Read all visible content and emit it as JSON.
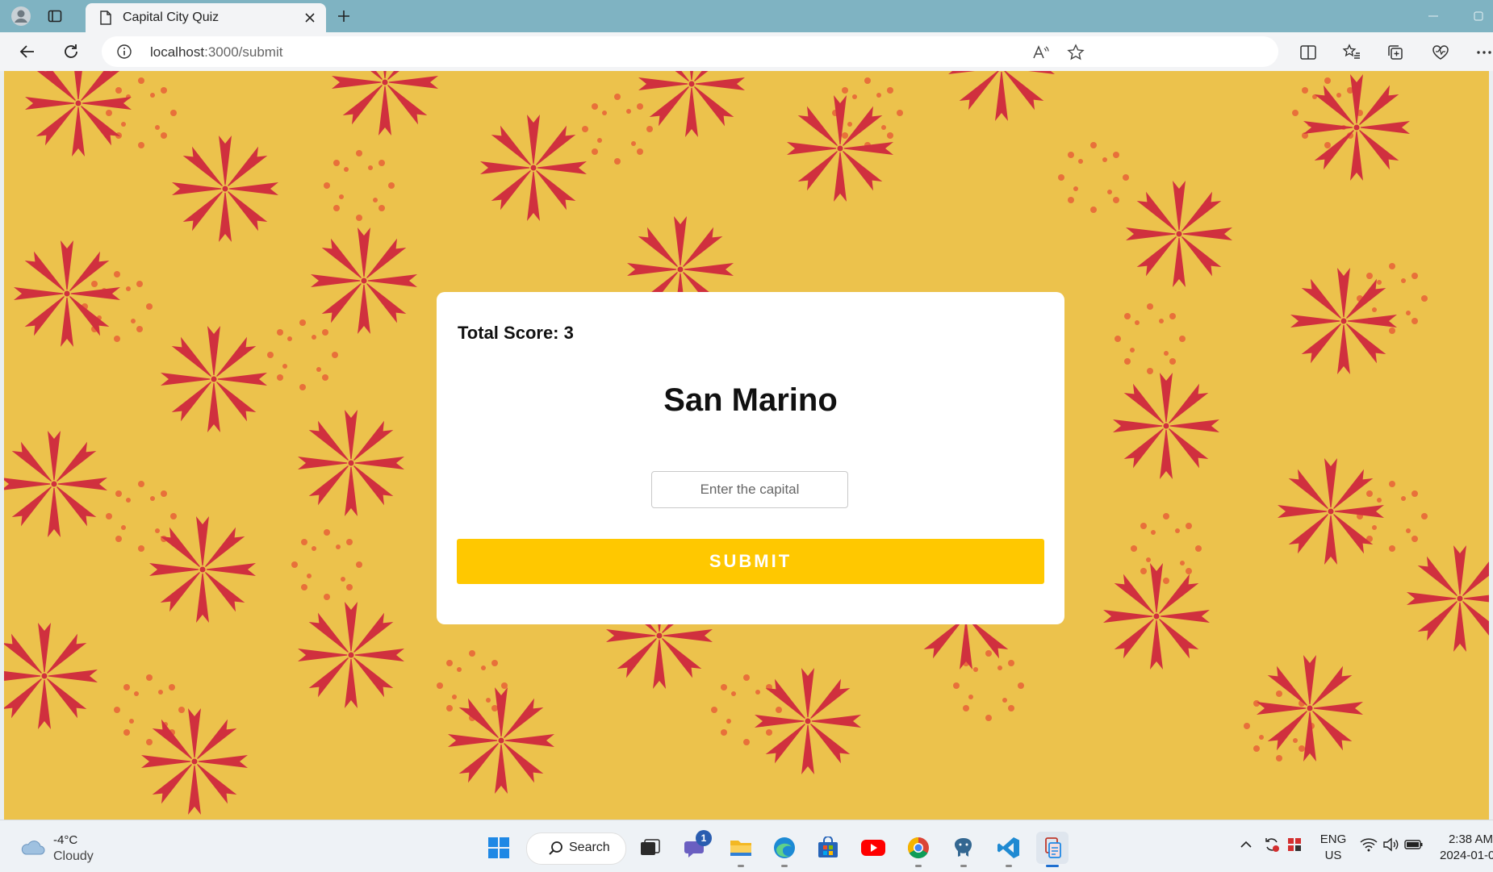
{
  "browser": {
    "tab_title": "Capital City Quiz",
    "url_host": "localhost",
    "url_path": ":3000/submit"
  },
  "quiz": {
    "score_label": "Total Score: 3",
    "country": "San Marino",
    "answer_placeholder": "Enter the capital",
    "answer_value": "",
    "submit_label": "SUBMIT"
  },
  "colors": {
    "background": "#ecc24c",
    "star": "#d0303e",
    "dots": "#e8703a",
    "submit": "#ffc800"
  },
  "taskbar": {
    "weather_temp": "-4°C",
    "weather_condition": "Cloudy",
    "search_label": "Search",
    "chat_badge": "1",
    "lang_primary": "ENG",
    "lang_secondary": "US",
    "time": "2:38 AM",
    "date": "2024-01-0"
  }
}
